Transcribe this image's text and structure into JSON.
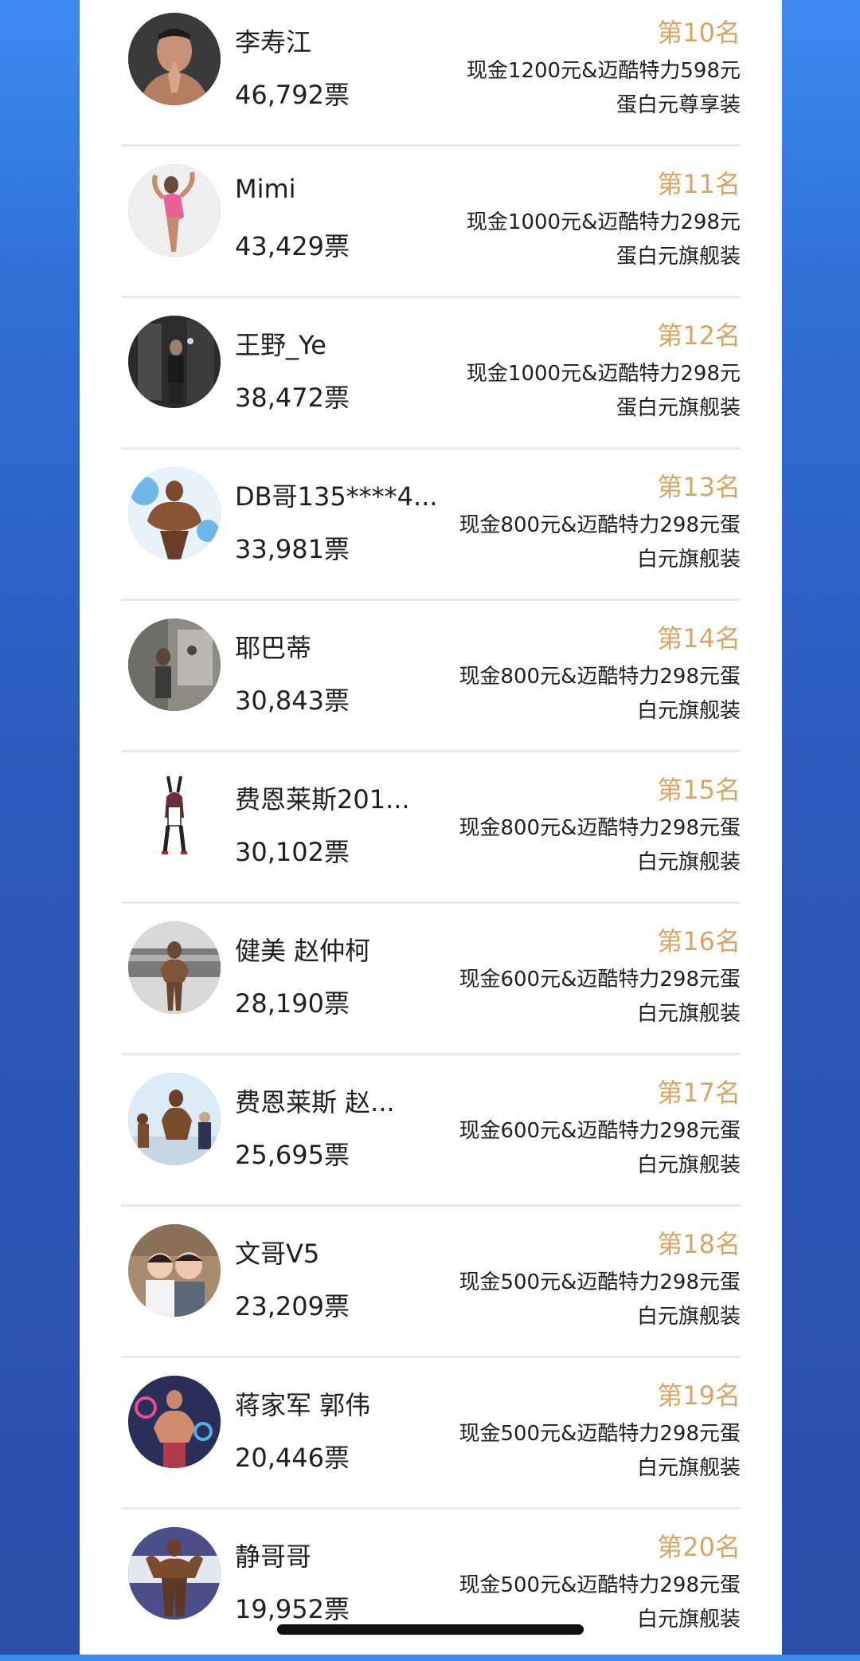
{
  "colors": {
    "rank_gold": "#d9a567",
    "text_dark": "#1f1f1f",
    "divider": "#e9e9e9",
    "page_blue": "#2f6fd6"
  },
  "leaderboard": [
    {
      "name": "李寿江",
      "votes": "46,792票",
      "rank": "第10名",
      "prize": "现金1200元&迈酷特力598元蛋白元尊享装",
      "avatar_icon": "avatar-photo-man-praying"
    },
    {
      "name": "Mimi",
      "votes": "43,429票",
      "rank": "第11名",
      "prize": "现金1000元&迈酷特力298元蛋白元旗舰装",
      "avatar_icon": "avatar-photo-woman-pink"
    },
    {
      "name": "王野_Ye",
      "votes": "38,472票",
      "rank": "第12名",
      "prize": "现金1000元&迈酷特力298元蛋白元旗舰装",
      "avatar_icon": "avatar-photo-gym-mirror"
    },
    {
      "name": "DB哥135****4...",
      "votes": "33,981票",
      "rank": "第13名",
      "prize": "现金800元&迈酷特力298元蛋白元旗舰装",
      "avatar_icon": "avatar-photo-bodybuilder-pose"
    },
    {
      "name": "耶巴蒂",
      "votes": "30,843票",
      "rank": "第14名",
      "prize": "现金800元&迈酷特力298元蛋白元旗舰装",
      "avatar_icon": "avatar-photo-gym-selfie"
    },
    {
      "name": "费恩莱斯201...",
      "votes": "30,102票",
      "rank": "第15名",
      "prize": "现金800元&迈酷特力298元蛋白元旗舰装",
      "avatar_icon": "avatar-cartoon-bunny-girl"
    },
    {
      "name": "健美 赵仲柯",
      "votes": "28,190票",
      "rank": "第16名",
      "prize": "现金600元&迈酷特力298元蛋白元旗舰装",
      "avatar_icon": "avatar-photo-competition-stage"
    },
    {
      "name": "费恩莱斯 赵...",
      "votes": "25,695票",
      "rank": "第17名",
      "prize": "现金600元&迈酷特力298元蛋白元旗舰装",
      "avatar_icon": "avatar-photo-posing-group"
    },
    {
      "name": "文哥V5",
      "votes": "23,209票",
      "rank": "第18名",
      "prize": "现金500元&迈酷特力298元蛋白元旗舰装",
      "avatar_icon": "avatar-photo-two-kids"
    },
    {
      "name": "蒋家军 郭伟",
      "votes": "20,446票",
      "rank": "第19名",
      "prize": "现金500元&迈酷特力298元蛋白元旗舰装",
      "avatar_icon": "avatar-photo-muscle-neon"
    },
    {
      "name": "静哥哥",
      "votes": "19,952票",
      "rank": "第20名",
      "prize": "现金500元&迈酷特力298元蛋白元旗舰装",
      "avatar_icon": "avatar-photo-bodybuilder-banner"
    }
  ]
}
